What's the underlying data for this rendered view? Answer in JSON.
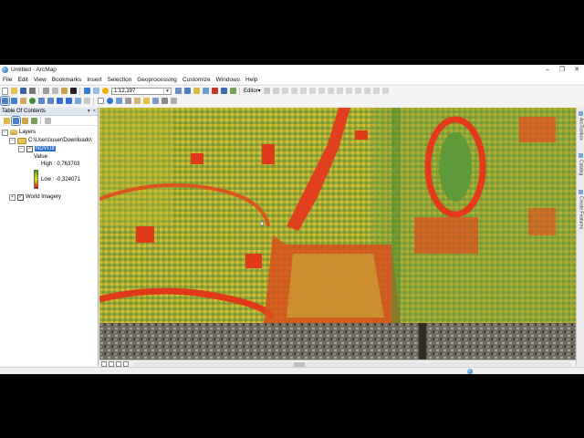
{
  "window": {
    "title": "Untitled - ArcMap",
    "controls": [
      "–",
      "❐",
      "✕"
    ]
  },
  "menubar": {
    "items": [
      "File",
      "Edit",
      "View",
      "Bookmarks",
      "Insert",
      "Selection",
      "Geoprocessing",
      "Customize",
      "Windows",
      "Help"
    ]
  },
  "toolbar": {
    "scale": "1:12,197",
    "editor_label": "Editor▾"
  },
  "toc": {
    "title": "Table Of Contents",
    "header_controls": [
      "▾",
      "×"
    ],
    "layers_label": "Layers",
    "folder_label": "C:\\Users\\user\\Downloads\\",
    "ndvi_layer": "NDVI.tif",
    "legend_title": "Value",
    "legend_high": "High : 0,763703",
    "legend_low": "Low : -0,324071",
    "imagery_layer": "World Imagery"
  },
  "right_dock": {
    "tabs": [
      "ArcToolbox",
      "Catalog",
      "Create Features"
    ]
  },
  "colors": {
    "ndvi_high": "#38a800",
    "ndvi_mid": "#e8e800",
    "ndvi_low": "#e80000",
    "selection": "#2f6fd1"
  }
}
